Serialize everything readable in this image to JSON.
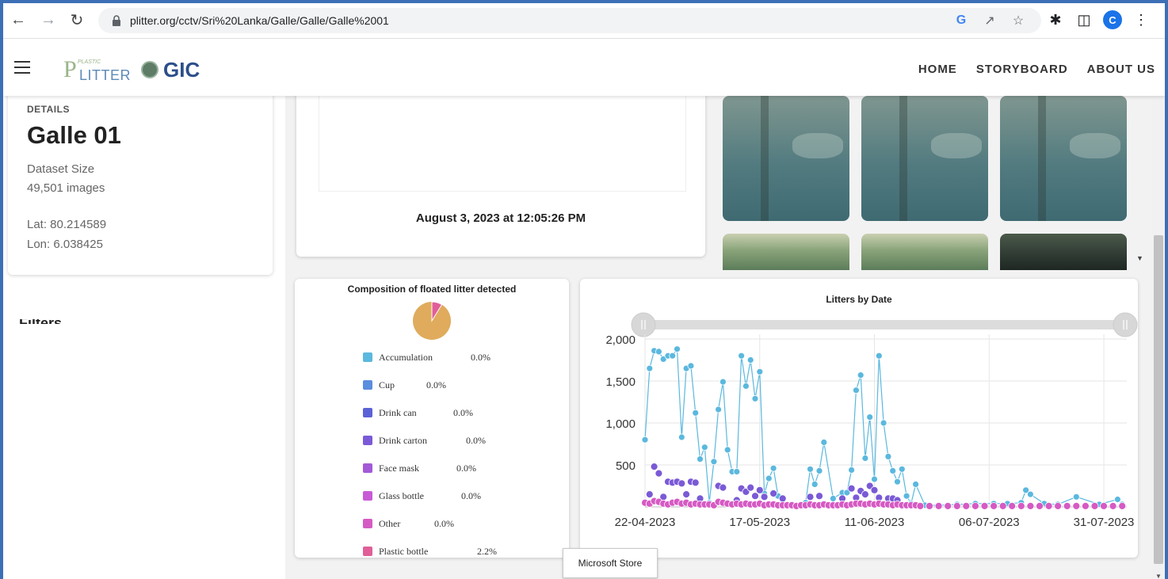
{
  "browser": {
    "url": "plitter.org/cctv/Sri%20Lanka/Galle/Galle/Galle%2001",
    "profile_initial": "C",
    "icons": [
      "back-arrow-icon",
      "forward-arrow-icon",
      "reload-icon",
      "lock-icon",
      "google-lens-icon",
      "share-icon",
      "star-icon",
      "extensions-puzzle-icon",
      "side-panel-icon",
      "profile-avatar-icon",
      "kebab-menu-icon"
    ]
  },
  "header": {
    "logo_plitter_small": "PLASTIC",
    "logo_plitter_big": "P",
    "logo_plitter_rest": "LITTER",
    "logo_gic": "GIC",
    "nav": [
      "HOME",
      "STORYBOARD",
      "ABOUT US"
    ]
  },
  "details": {
    "label": "DETAILS",
    "title": "Galle 01",
    "dataset_size_label": "Dataset Size",
    "dataset_size_value": "49,501 images",
    "lat": "Lat: 80.214589",
    "lon": "Lon: 6.038425",
    "filter_heading": "Filters"
  },
  "image_panel": {
    "caption": "August 3, 2023 at 12:05:26 PM"
  },
  "tooltip": "Microsoft Store",
  "colors": {
    "accent": "#5bb8de",
    "pie_main": "#e0ab5c",
    "pie_slice": "#e05f98"
  },
  "chart_data": [
    {
      "type": "pie",
      "title": "Composition of floated litter detected",
      "categories": [
        "Accumulation",
        "Cup",
        "Drink can",
        "Drink carton",
        "Face mask",
        "Glass bottle",
        "Other",
        "Plastic bottle"
      ],
      "legend_values": [
        "0.0%",
        "0.0%",
        "0.0%",
        "0.0%",
        "0.0%",
        "0.0%",
        "0.0%",
        "2.2%"
      ],
      "colors": [
        "#5bb8de",
        "#5a8ede",
        "#5a62d6",
        "#7a5ad6",
        "#a35ad6",
        "#c85ad6",
        "#d65ac3",
        "#e05f98"
      ],
      "visible_slice_share": 0.022,
      "remaining_color": "#e0ab5c"
    },
    {
      "type": "scatter",
      "title": "Litters by Date",
      "xlabel": "",
      "ylabel": "",
      "x_ticks": [
        "22-04-2023",
        "17-05-2023",
        "11-06-2023",
        "06-07-2023",
        "31-07-2023"
      ],
      "y_ticks": [
        "2,000",
        "1,500",
        "1,000",
        "500"
      ],
      "ylim": [
        0,
        2000
      ],
      "x_range_days": [
        0,
        105
      ],
      "grid": true,
      "has_range_slider": true,
      "series": [
        {
          "color": "#5bb8de",
          "line": true,
          "points": [
            [
              0,
              800
            ],
            [
              1,
              1650
            ],
            [
              2,
              1860
            ],
            [
              3,
              1850
            ],
            [
              4,
              1760
            ],
            [
              5,
              1800
            ],
            [
              6,
              1800
            ],
            [
              7,
              1880
            ],
            [
              8,
              830
            ],
            [
              9,
              1650
            ],
            [
              10,
              1680
            ],
            [
              11,
              1120
            ],
            [
              12,
              570
            ],
            [
              13,
              710
            ],
            [
              14,
              50
            ],
            [
              15,
              540
            ],
            [
              16,
              1160
            ],
            [
              17,
              1490
            ],
            [
              18,
              680
            ],
            [
              19,
              420
            ],
            [
              20,
              420
            ],
            [
              21,
              1800
            ],
            [
              22,
              1440
            ],
            [
              23,
              1750
            ],
            [
              24,
              1290
            ],
            [
              25,
              1610
            ],
            [
              26,
              160
            ],
            [
              27,
              340
            ],
            [
              28,
              460
            ],
            [
              29,
              130
            ],
            [
              30,
              80
            ],
            [
              31,
              30
            ],
            [
              33,
              20
            ],
            [
              34,
              20
            ],
            [
              35,
              50
            ],
            [
              36,
              450
            ],
            [
              37,
              270
            ],
            [
              38,
              430
            ],
            [
              39,
              770
            ],
            [
              41,
              100
            ],
            [
              43,
              170
            ],
            [
              44,
              170
            ],
            [
              45,
              440
            ],
            [
              46,
              1390
            ],
            [
              47,
              1570
            ],
            [
              48,
              580
            ],
            [
              49,
              1070
            ],
            [
              50,
              330
            ],
            [
              51,
              1800
            ],
            [
              52,
              1000
            ],
            [
              53,
              600
            ],
            [
              54,
              430
            ],
            [
              55,
              300
            ],
            [
              56,
              450
            ],
            [
              57,
              130
            ],
            [
              58,
              40
            ],
            [
              59,
              270
            ],
            [
              61,
              20
            ],
            [
              64,
              20
            ],
            [
              68,
              30
            ],
            [
              72,
              40
            ],
            [
              76,
              40
            ],
            [
              79,
              40
            ],
            [
              82,
              50
            ],
            [
              83,
              200
            ],
            [
              84,
              150
            ],
            [
              87,
              40
            ],
            [
              90,
              30
            ],
            [
              94,
              120
            ],
            [
              99,
              30
            ],
            [
              103,
              90
            ],
            [
              104,
              30
            ]
          ]
        },
        {
          "color": "#7a5ad6",
          "line": false,
          "points": [
            [
              1,
              150
            ],
            [
              2,
              480
            ],
            [
              3,
              400
            ],
            [
              4,
              120
            ],
            [
              5,
              300
            ],
            [
              6,
              290
            ],
            [
              7,
              300
            ],
            [
              8,
              280
            ],
            [
              9,
              150
            ],
            [
              10,
              300
            ],
            [
              11,
              290
            ],
            [
              12,
              100
            ],
            [
              16,
              250
            ],
            [
              17,
              230
            ],
            [
              20,
              80
            ],
            [
              21,
              220
            ],
            [
              22,
              180
            ],
            [
              23,
              230
            ],
            [
              24,
              130
            ],
            [
              25,
              200
            ],
            [
              26,
              120
            ],
            [
              28,
              160
            ],
            [
              30,
              100
            ],
            [
              36,
              120
            ],
            [
              38,
              130
            ],
            [
              43,
              100
            ],
            [
              45,
              220
            ],
            [
              46,
              110
            ],
            [
              47,
              190
            ],
            [
              48,
              150
            ],
            [
              49,
              250
            ],
            [
              50,
              200
            ],
            [
              51,
              110
            ],
            [
              53,
              100
            ],
            [
              54,
              100
            ],
            [
              55,
              80
            ]
          ]
        },
        {
          "color": "#d65ac3",
          "line": false,
          "points": [
            [
              0,
              50
            ],
            [
              1,
              40
            ],
            [
              2,
              70
            ],
            [
              3,
              60
            ],
            [
              4,
              40
            ],
            [
              5,
              30
            ],
            [
              6,
              50
            ],
            [
              7,
              60
            ],
            [
              8,
              40
            ],
            [
              9,
              50
            ],
            [
              10,
              30
            ],
            [
              11,
              40
            ],
            [
              12,
              30
            ],
            [
              13,
              30
            ],
            [
              14,
              30
            ],
            [
              15,
              20
            ],
            [
              16,
              60
            ],
            [
              17,
              50
            ],
            [
              18,
              40
            ],
            [
              19,
              30
            ],
            [
              20,
              40
            ],
            [
              21,
              30
            ],
            [
              22,
              40
            ],
            [
              23,
              30
            ],
            [
              24,
              30
            ],
            [
              25,
              40
            ],
            [
              26,
              20
            ],
            [
              27,
              30
            ],
            [
              28,
              30
            ],
            [
              29,
              20
            ],
            [
              30,
              20
            ],
            [
              31,
              20
            ],
            [
              32,
              20
            ],
            [
              33,
              10
            ],
            [
              34,
              20
            ],
            [
              35,
              20
            ],
            [
              36,
              30
            ],
            [
              37,
              20
            ],
            [
              38,
              20
            ],
            [
              39,
              30
            ],
            [
              40,
              20
            ],
            [
              41,
              20
            ],
            [
              42,
              20
            ],
            [
              43,
              30
            ],
            [
              44,
              20
            ],
            [
              45,
              30
            ],
            [
              46,
              40
            ],
            [
              47,
              40
            ],
            [
              48,
              30
            ],
            [
              49,
              40
            ],
            [
              50,
              30
            ],
            [
              51,
              40
            ],
            [
              52,
              30
            ],
            [
              53,
              30
            ],
            [
              54,
              20
            ],
            [
              55,
              30
            ],
            [
              56,
              20
            ],
            [
              57,
              20
            ],
            [
              58,
              20
            ],
            [
              59,
              20
            ],
            [
              60,
              10
            ],
            [
              62,
              10
            ],
            [
              64,
              10
            ],
            [
              66,
              10
            ],
            [
              68,
              10
            ],
            [
              70,
              10
            ],
            [
              72,
              10
            ],
            [
              74,
              10
            ],
            [
              76,
              10
            ],
            [
              78,
              10
            ],
            [
              80,
              10
            ],
            [
              82,
              10
            ],
            [
              84,
              10
            ],
            [
              86,
              10
            ],
            [
              88,
              10
            ],
            [
              90,
              10
            ],
            [
              92,
              10
            ],
            [
              94,
              10
            ],
            [
              96,
              10
            ],
            [
              98,
              10
            ],
            [
              100,
              10
            ],
            [
              102,
              10
            ],
            [
              104,
              10
            ]
          ]
        }
      ]
    }
  ]
}
